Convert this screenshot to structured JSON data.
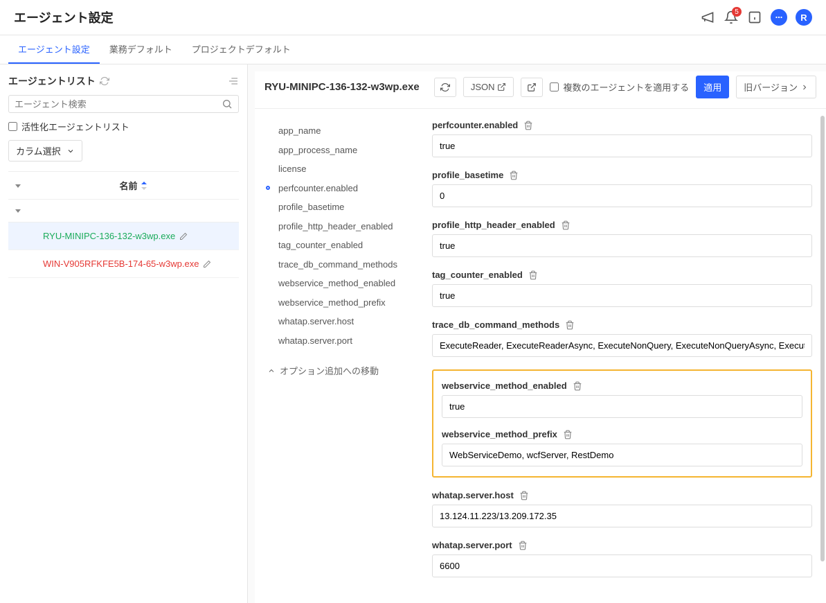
{
  "header": {
    "title": "エージェント設定",
    "notification_count": "5",
    "avatar_letter": "R"
  },
  "tabs": [
    {
      "label": "エージェント設定",
      "active": true
    },
    {
      "label": "業務デフォルト",
      "active": false
    },
    {
      "label": "プロジェクトデフォルト",
      "active": false
    }
  ],
  "sidebar": {
    "title": "エージェントリスト",
    "search_placeholder": "エージェント検索",
    "active_agent_label": "活性化エージェントリスト",
    "column_select": "カラム選択",
    "header_name": "名前",
    "agents": [
      {
        "name": "RYU-MINIPC-136-132-w3wp.exe",
        "status": "green",
        "selected": true
      },
      {
        "name": "WIN-V905RFKFE5B-174-65-w3wp.exe",
        "status": "red",
        "selected": false
      }
    ]
  },
  "main": {
    "title": "RYU-MINIPC-136-132-w3wp.exe",
    "json_btn": "JSON",
    "multi_apply_label": "複数のエージェントを適用する",
    "apply_btn": "適用",
    "old_version_btn": "旧バージョン",
    "nav_items": [
      "app_name",
      "app_process_name",
      "license",
      "perfcounter.enabled",
      "profile_basetime",
      "profile_http_header_enabled",
      "tag_counter_enabled",
      "trace_db_command_methods",
      "webservice_method_enabled",
      "webservice_method_prefix",
      "whatap.server.host",
      "whatap.server.port"
    ],
    "nav_active_index": 3,
    "nav_jump": "オプション追加への移動",
    "fields": [
      {
        "key": "perfcounter.enabled",
        "value": "true"
      },
      {
        "key": "profile_basetime",
        "value": "0"
      },
      {
        "key": "profile_http_header_enabled",
        "value": "true"
      },
      {
        "key": "tag_counter_enabled",
        "value": "true"
      },
      {
        "key": "trace_db_command_methods",
        "value": "ExecuteReader, ExecuteReaderAsync, ExecuteNonQuery, ExecuteNonQueryAsync, ExecuteScalar"
      },
      {
        "key": "webservice_method_enabled",
        "value": "true",
        "highlight": true
      },
      {
        "key": "webservice_method_prefix",
        "value": "WebServiceDemo, wcfServer, RestDemo",
        "highlight": true
      },
      {
        "key": "whatap.server.host",
        "value": "13.124.11.223/13.209.172.35"
      },
      {
        "key": "whatap.server.port",
        "value": "6600"
      }
    ]
  }
}
